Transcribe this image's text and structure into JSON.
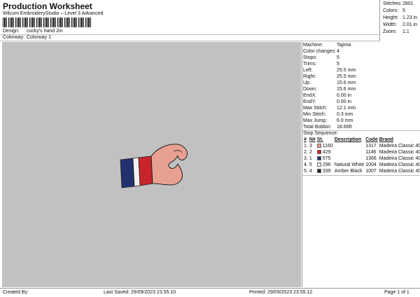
{
  "header": {
    "title": "Production Worksheet",
    "subtitle": "Wilcom EmbroideryStudio – Level 3 Advanced",
    "design_label": "Design:",
    "design_value": "cucky's hand 2in",
    "colorway_label": "Colorway:",
    "colorway_value": "Colorway 1"
  },
  "summary": {
    "stitches_label": "Stitches:",
    "stitches": "2801",
    "colors_label": "Colors:",
    "colors": "5",
    "height_label": "Height:",
    "height": "1.23 in",
    "width_label": "Width:",
    "width": "2.01 in",
    "zoom_label": "Zoom:",
    "zoom": "1:1"
  },
  "details": {
    "machine_label": "Machine:",
    "machine": "Tajima",
    "color_changes_label": "Color changes:",
    "color_changes": "4",
    "stops_label": "Stops:",
    "stops": "5",
    "trims_label": "Trims:",
    "trims": "5",
    "left_label": "Left:",
    "left": "25.5 mm",
    "right_label": "Right:",
    "right": "25.5 mm",
    "up_label": "Up:",
    "up": "15.6 mm",
    "down_label": "Down:",
    "down": "15.6 mm",
    "endx_label": "EndX:",
    "endx": "0.00 in",
    "endy_label": "EndY:",
    "endy": "0.00 in",
    "max_stitch_label": "Max Stitch:",
    "max_stitch": "12.1 mm",
    "min_stitch_label": "Min Stitch:",
    "min_stitch": "0.3 mm",
    "max_jump_label": "Max Jump:",
    "max_jump": "6.0 mm",
    "total_bobbin_label": "Total Bobbin:",
    "total_bobbin": "18.66ft"
  },
  "stop_sequence": {
    "title": "Stop Sequence:",
    "headers": [
      "#",
      "N#",
      "St.",
      "Description",
      "Code",
      "Brand"
    ],
    "rows": [
      {
        "idx": "1.",
        "n": "3",
        "color": "#e8a090",
        "st": "1160",
        "desc": "",
        "code": "1317",
        "brand": "Madeira Classic 40"
      },
      {
        "idx": "2.",
        "n": "2",
        "color": "#c8242a",
        "st": "429",
        "desc": "",
        "code": "1146",
        "brand": "Madeira Classic 40"
      },
      {
        "idx": "3.",
        "n": "1",
        "color": "#23306e",
        "st": "575",
        "desc": "",
        "code": "1366",
        "brand": "Madeira Classic 40"
      },
      {
        "idx": "4.",
        "n": "5",
        "color": "#f2f2f2",
        "st": "296",
        "desc": "Natural White",
        "code": "1004",
        "brand": "Madeira Classic 40"
      },
      {
        "idx": "5.",
        "n": "4",
        "color": "#222222",
        "st": "339",
        "desc": "Amber Black",
        "code": "1007",
        "brand": "Madeira Classic 40"
      }
    ]
  },
  "footer": {
    "created_by": "Created By:",
    "last_saved": "Last Saved: 29/09/2023 23.55.10",
    "printed": "Printed: 29/09/2023 23.55.12",
    "page": "Page 1 of 1"
  },
  "colors": {
    "canvas": "#c1c1c1",
    "skin": "#e8a090",
    "red": "#c8242a",
    "navy": "#23306e",
    "white": "#f2f2f2",
    "outline": "#222222"
  }
}
